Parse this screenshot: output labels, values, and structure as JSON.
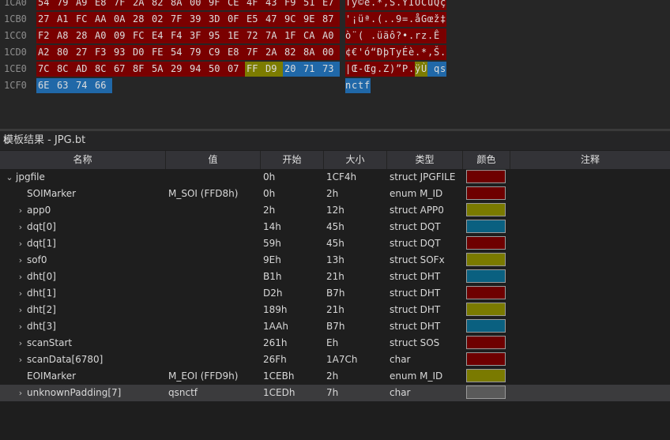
{
  "hex": {
    "rows": [
      {
        "addr": "1CA0",
        "bytes": [
          "54",
          "79",
          "A9",
          "E8",
          "7F",
          "2A",
          "82",
          "8A",
          "00",
          "9F",
          "CE",
          "4F",
          "43",
          "F9",
          "51",
          "E7"
        ],
        "ascii": "Ty©è.*,Š.ŸÎOCùQç"
      },
      {
        "addr": "1CB0",
        "bytes": [
          "27",
          "A1",
          "FC",
          "AA",
          "0A",
          "28",
          "02",
          "7F",
          "39",
          "3D",
          "0F",
          "E5",
          "47",
          "9C",
          "9E",
          "87"
        ],
        "ascii": "'¡üª.(..9=.åGœž‡"
      },
      {
        "addr": "1CC0",
        "bytes": [
          "F2",
          "A8",
          "28",
          "A0",
          "09",
          "FC",
          "E4",
          "F4",
          "3F",
          "95",
          "1E",
          "72",
          "7A",
          "1F",
          "CA",
          "A0"
        ],
        "ascii": "ò¨( .üäô?•.rz.Ê "
      },
      {
        "addr": "1CD0",
        "bytes": [
          "A2",
          "80",
          "27",
          "F3",
          "93",
          "D0",
          "FE",
          "54",
          "79",
          "C9",
          "E8",
          "7F",
          "2A",
          "82",
          "8A",
          "00"
        ],
        "ascii": "¢€'ó“ÐþTyÉè.*‚Š."
      },
      {
        "addr": "1CE0",
        "bytes": [
          "7C",
          "8C",
          "AD",
          "8C",
          "67",
          "8F",
          "5A",
          "29",
          "94",
          "50",
          "07",
          "FF",
          "D9",
          "20",
          "71",
          "73"
        ],
        "ascii": "|Œ-Œg.Z)”P.ÿÙ qs"
      },
      {
        "addr": "1CF0",
        "bytes": [
          "6E",
          "63",
          "74",
          "66"
        ],
        "ascii": "nctf"
      }
    ]
  },
  "panel": {
    "title": "模板结果 - JPG.bt",
    "refresh_icon": "refresh-icon"
  },
  "columns": {
    "name": "名称",
    "value": "值",
    "start": "开始",
    "size": "大小",
    "type": "类型",
    "color": "颜色",
    "comment": "注释"
  },
  "rows": [
    {
      "name": "jpgfile",
      "value": "",
      "start": "0h",
      "size": "1CF4h",
      "type": "struct JPGFILE",
      "color": "#6e0000",
      "expander": "open",
      "indent": 0
    },
    {
      "name": "SOIMarker",
      "value": "M_SOI (FFD8h)",
      "start": "0h",
      "size": "2h",
      "type": "enum M_ID",
      "color": "#6e0000",
      "expander": "none",
      "indent": 1
    },
    {
      "name": "app0",
      "value": "",
      "start": "2h",
      "size": "12h",
      "type": "struct APP0",
      "color": "#7a7a00",
      "expander": "closed",
      "indent": 1
    },
    {
      "name": "dqt[0]",
      "value": "",
      "start": "14h",
      "size": "45h",
      "type": "struct DQT",
      "color": "#0a6080",
      "expander": "closed",
      "indent": 1
    },
    {
      "name": "dqt[1]",
      "value": "",
      "start": "59h",
      "size": "45h",
      "type": "struct DQT",
      "color": "#6e0000",
      "expander": "closed",
      "indent": 1
    },
    {
      "name": "sof0",
      "value": "",
      "start": "9Eh",
      "size": "13h",
      "type": "struct SOFx",
      "color": "#7a7a00",
      "expander": "closed",
      "indent": 1
    },
    {
      "name": "dht[0]",
      "value": "",
      "start": "B1h",
      "size": "21h",
      "type": "struct DHT",
      "color": "#0a6080",
      "expander": "closed",
      "indent": 1
    },
    {
      "name": "dht[1]",
      "value": "",
      "start": "D2h",
      "size": "B7h",
      "type": "struct DHT",
      "color": "#6e0000",
      "expander": "closed",
      "indent": 1
    },
    {
      "name": "dht[2]",
      "value": "",
      "start": "189h",
      "size": "21h",
      "type": "struct DHT",
      "color": "#7a7a00",
      "expander": "closed",
      "indent": 1
    },
    {
      "name": "dht[3]",
      "value": "",
      "start": "1AAh",
      "size": "B7h",
      "type": "struct DHT",
      "color": "#0a6080",
      "expander": "closed",
      "indent": 1
    },
    {
      "name": "scanStart",
      "value": "",
      "start": "261h",
      "size": "Eh",
      "type": "struct SOS",
      "color": "#6e0000",
      "expander": "closed",
      "indent": 1
    },
    {
      "name": "scanData[6780]",
      "value": "",
      "start": "26Fh",
      "size": "1A7Ch",
      "type": "char",
      "color": "#6e0000",
      "expander": "closed",
      "indent": 1
    },
    {
      "name": "EOIMarker",
      "value": "M_EOI (FFD9h)",
      "start": "1CEBh",
      "size": "2h",
      "type": "enum M_ID",
      "color": "#7a7a00",
      "expander": "none",
      "indent": 1
    },
    {
      "name": "unknownPadding[7]",
      "value": "qsnctf",
      "start": "1CEDh",
      "size": "7h",
      "type": "char",
      "color": "#5a5a5a",
      "expander": "closed",
      "indent": 1,
      "selected": true
    }
  ]
}
